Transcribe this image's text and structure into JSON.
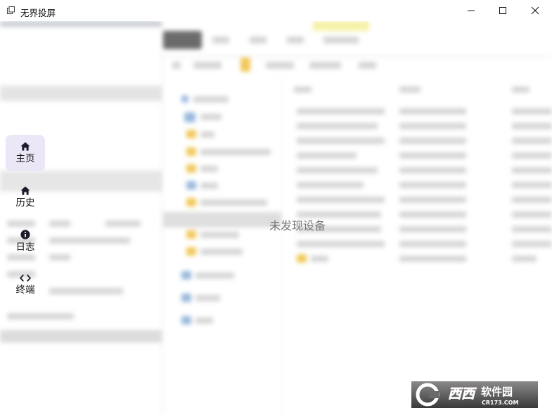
{
  "window": {
    "title": "无界投屏",
    "controls": [
      "minimize-icon",
      "maximize-icon",
      "close-icon"
    ]
  },
  "nav": {
    "items": [
      {
        "label": "主页",
        "icon": "home-icon",
        "active": true
      },
      {
        "label": "历史",
        "icon": "home-icon",
        "active": false
      },
      {
        "label": "日志",
        "icon": "info-icon",
        "active": false
      },
      {
        "label": "终端",
        "icon": "code-icon",
        "active": false
      }
    ]
  },
  "main": {
    "empty_message": "未发现设备"
  },
  "watermark": {
    "logo_text": "西西软件园",
    "site": "CR173.COM"
  },
  "colors": {
    "active_nav_bg": "#e9e4f6",
    "icon": "#1c1b2a",
    "watermark_accent": "#e0342b"
  }
}
